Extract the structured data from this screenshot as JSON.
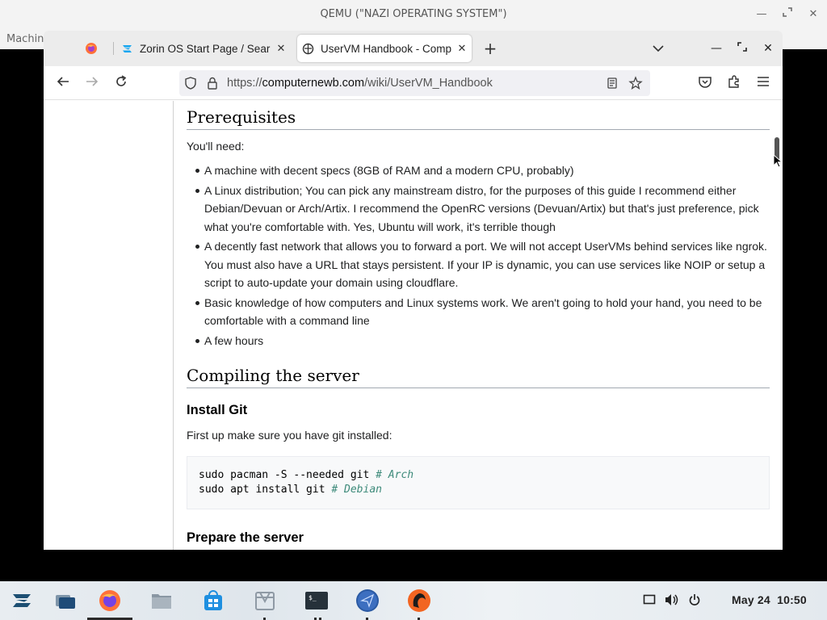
{
  "qemu": {
    "title": "QEMU (\"NAZI OPERATING SYSTEM\")",
    "menu_machine": "Machin"
  },
  "browser": {
    "tabs": [
      {
        "title": "",
        "icon": "firefox-icon"
      },
      {
        "title": "Zorin OS Start Page / Sear",
        "icon": "zorin-icon"
      },
      {
        "title": "UserVM Handbook - Comp",
        "icon": "wiki-icon",
        "active": true
      }
    ],
    "url_prefix": "https://",
    "url_domain": "computernewb.com",
    "url_path": "/wiki/UserVM_Handbook"
  },
  "article": {
    "h_prereq": "Prerequisites",
    "need": "You'll need:",
    "bullets": [
      "A machine with decent specs (8GB of RAM and a modern CPU, probably)",
      "A Linux distribution; You can pick any mainstream distro, for the purposes of this guide I recommend either Debian/Devuan or Arch/Artix. I recommend the OpenRC versions (Devuan/Artix) but that's just preference, pick what you're comfortable with. Yes, Ubuntu will work, it's terrible though",
      "A decently fast network that allows you to forward a port. We will not accept UserVMs behind services like ngrok. You must also have a URL that stays persistent. If your IP is dynamic, you can use services like NOIP or setup a script to auto-update your domain using cloudflare.",
      "Basic knowledge of how computers and Linux systems work. We aren't going to hold your hand, you need to be comfortable with a command line",
      "A few hours"
    ],
    "h_compile": "Compiling the server",
    "h_git": "Install Git",
    "git_intro": "First up make sure you have git installed:",
    "code": [
      {
        "cmd": "sudo pacman -S --needed git ",
        "comment": "# Arch"
      },
      {
        "cmd": "sudo apt install git ",
        "comment": "# Debian"
      }
    ],
    "h_prepare": "Prepare the server"
  },
  "taskbar": {
    "date": "May 24",
    "time": "10:50"
  },
  "colors": {
    "accent_blue": "#0a84ff",
    "firefox_orange": "#ff7139",
    "code_comment": "#3d8a7a"
  }
}
